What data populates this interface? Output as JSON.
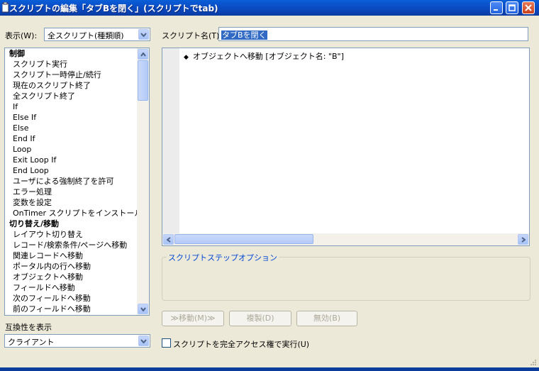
{
  "window": {
    "title": "スクリプトの編集「タブBを閉く」(スクリプトでtab)"
  },
  "view": {
    "label": "表示(W):",
    "selected": "全スクリプト(種類順)"
  },
  "script_name": {
    "label": "スクリプト名(T):",
    "value": "タブBを閉く"
  },
  "steps_list": [
    {
      "label": "制御",
      "category": true
    },
    {
      "label": "スクリプト実行"
    },
    {
      "label": "スクリプト一時停止/続行"
    },
    {
      "label": "現在のスクリプト終了"
    },
    {
      "label": "全スクリプト終了"
    },
    {
      "label": "If"
    },
    {
      "label": "Else If"
    },
    {
      "label": "Else"
    },
    {
      "label": "End If"
    },
    {
      "label": "Loop"
    },
    {
      "label": "Exit Loop If"
    },
    {
      "label": "End Loop"
    },
    {
      "label": "ユーザによる強制終了を許可"
    },
    {
      "label": "エラー処理"
    },
    {
      "label": "変数を設定"
    },
    {
      "label": "OnTimer スクリプトをインストール"
    },
    {
      "label": "切り替え/移動",
      "category": true
    },
    {
      "label": "レイアウト切り替え"
    },
    {
      "label": "レコード/検索条件/ページへ移動"
    },
    {
      "label": "関連レコードへ移動"
    },
    {
      "label": "ポータル内の行へ移動"
    },
    {
      "label": "オブジェクトへ移動"
    },
    {
      "label": "フィールドへ移動"
    },
    {
      "label": "次のフィールドへ移動"
    },
    {
      "label": "前のフィールドへ移動"
    }
  ],
  "script_steps": [
    {
      "text": "オブジェクトへ移動 [オブジェクト名: \"B\"]"
    }
  ],
  "options": {
    "title": "スクリプトステップオプション"
  },
  "buttons": {
    "move": "≫移動(M)≫",
    "duplicate": "複製(D)",
    "disable": "無効(B)"
  },
  "compat": {
    "label": "互換性を表示",
    "selected": "クライアント"
  },
  "full_access": {
    "label": "スクリプトを完全アクセス権で実行(U)",
    "checked": false
  }
}
